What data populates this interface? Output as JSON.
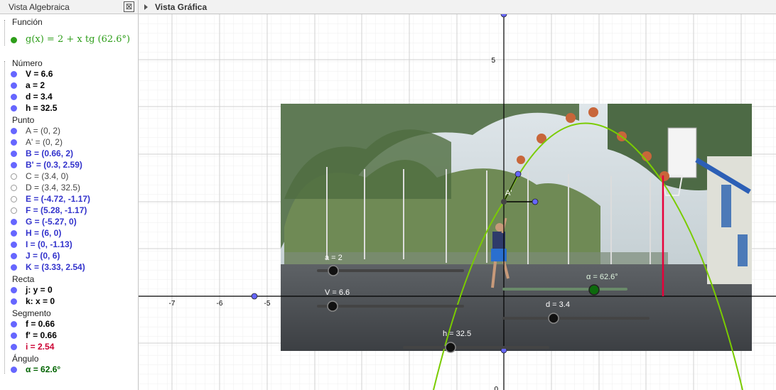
{
  "algebra": {
    "title": "Vista Algebraica",
    "close_label": "⊠",
    "categories": {
      "funcion": "Función",
      "numero": "Número",
      "punto": "Punto",
      "recta": "Recta",
      "segmento": "Segmento",
      "angulo": "Ángulo"
    },
    "function_g": "g(x) = 2 + x  tg (62.6°)",
    "numbers": [
      "V = 6.6",
      "a = 2",
      "d = 3.4",
      "h = 32.5"
    ],
    "points": [
      "A = (0, 2)",
      "A' = (0, 2)",
      "B = (0.66, 2)",
      "B' = (0.3, 2.59)",
      "C = (3.4, 0)",
      "D = (3.4, 32.5)",
      "E = (-4.72, -1.17)",
      "F = (5.28, -1.17)",
      "G = (-5.27, 0)",
      "H = (6, 0)",
      "I = (0, -1.13)",
      "J = (0, 6)",
      "K = (3.33, 2.54)"
    ],
    "lines": [
      "j: y = 0",
      "k: x = 0"
    ],
    "segments": [
      "f = 0.66",
      "f' = 0.66",
      "i = 2.54"
    ],
    "angles": [
      "α = 62.6°"
    ],
    "colors": {
      "point_dot": "#6666ff",
      "function": "#2e9e1a",
      "red": "#cc0033",
      "angle": "#006400"
    }
  },
  "graphics": {
    "title": "Vista Gráfica",
    "x_ticks": [
      "-7",
      "-6",
      "-5"
    ],
    "y_ticks": [
      "5",
      "0"
    ],
    "point_label": "A'",
    "sliders": {
      "a": "a = 2",
      "V": "V = 6.6",
      "alpha": "α = 62.6°",
      "d": "d = 3.4",
      "h": "h = 32.5"
    },
    "colors": {
      "curve": "#7acc00",
      "segment_red": "#e8003a",
      "point": "#6666ff"
    }
  }
}
